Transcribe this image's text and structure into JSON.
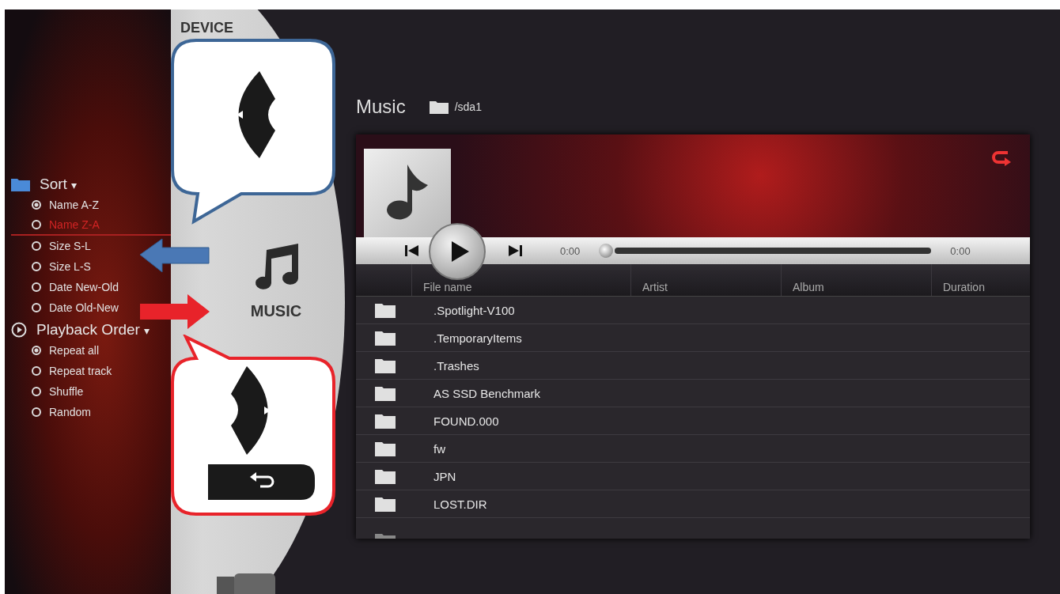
{
  "sidebar": {
    "sections": [
      {
        "kind": "folder",
        "title": "Sort",
        "caret": "▾",
        "items": [
          {
            "label": "Name A-Z",
            "selected": true,
            "focused": false
          },
          {
            "label": "Name Z-A",
            "selected": false,
            "focused": true
          },
          {
            "label": "Size S-L",
            "selected": false,
            "focused": false
          },
          {
            "label": "Size L-S",
            "selected": false,
            "focused": false
          },
          {
            "label": "Date New-Old",
            "selected": false,
            "focused": false
          },
          {
            "label": "Date Old-New",
            "selected": false,
            "focused": false
          }
        ]
      },
      {
        "kind": "play",
        "title": "Playback Order",
        "caret": "▾",
        "items": [
          {
            "label": "Repeat all",
            "selected": true,
            "focused": false
          },
          {
            "label": "Repeat track",
            "selected": false,
            "focused": false
          },
          {
            "label": "Shuffle",
            "selected": false,
            "focused": false
          },
          {
            "label": "Random",
            "selected": false,
            "focused": false
          }
        ]
      }
    ]
  },
  "wheel": {
    "top_label": "DEVICE",
    "current_label": "MUSIC"
  },
  "header": {
    "title": "Music",
    "path": "/sda1"
  },
  "player": {
    "elapsed": "0:00",
    "total": "0:00"
  },
  "table": {
    "columns": [
      "File name",
      "Artist",
      "Album",
      "Duration"
    ],
    "rows": [
      {
        "name": ".Spotlight-V100"
      },
      {
        "name": ".TemporaryItems"
      },
      {
        "name": ".Trashes"
      },
      {
        "name": "AS SSD Benchmark"
      },
      {
        "name": "FOUND.000"
      },
      {
        "name": "fw"
      },
      {
        "name": "JPN"
      },
      {
        "name": "LOST.DIR"
      }
    ]
  },
  "annotations": {
    "callouts": [
      {
        "kind": "left",
        "color": "#3d6696"
      },
      {
        "kind": "right_back",
        "color": "#e8232a"
      }
    ],
    "arrows": [
      {
        "kind": "left",
        "color": "#4a78b5"
      },
      {
        "kind": "right",
        "color": "#e8232a"
      }
    ]
  }
}
